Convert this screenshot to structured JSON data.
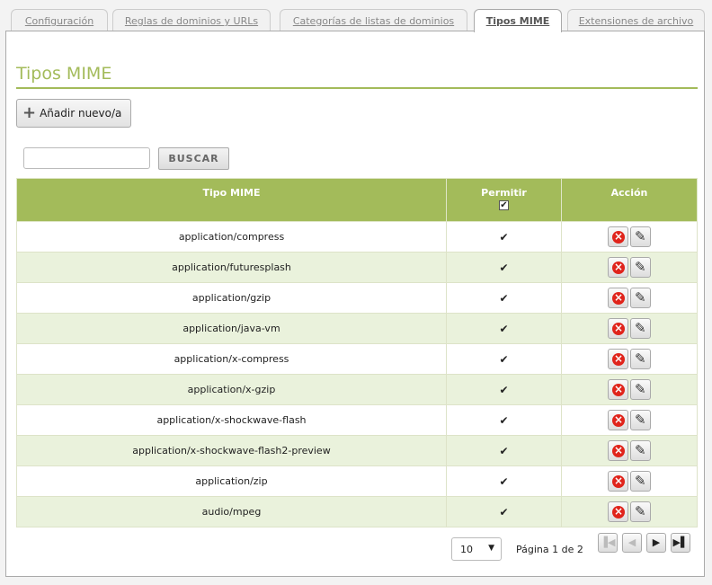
{
  "tabs": [
    {
      "label": "Configuración"
    },
    {
      "label": "Reglas de dominios y URLs"
    },
    {
      "label": "Categorías de listas de dominios"
    },
    {
      "label": "Tipos MIME"
    },
    {
      "label": "Extensiones de archivo"
    }
  ],
  "title": "Tipos MIME",
  "add_label": "Añadir nuevo/a",
  "search": {
    "value": "",
    "button": "BUSCAR"
  },
  "table": {
    "headers": [
      "Tipo MIME",
      "Permitir",
      "Acción"
    ],
    "rows": [
      "application/compress",
      "application/futuresplash",
      "application/gzip",
      "application/java-vm",
      "application/x-compress",
      "application/x-gzip",
      "application/x-shockwave-flash",
      "application/x-shockwave-flash2-preview",
      "application/zip",
      "audio/mpeg"
    ]
  },
  "footer": {
    "page_size": "10",
    "page_text": "Página 1 de 2"
  },
  "colors": {
    "accent": "#a3bb5a",
    "row_alt": "#eaf2dc"
  }
}
